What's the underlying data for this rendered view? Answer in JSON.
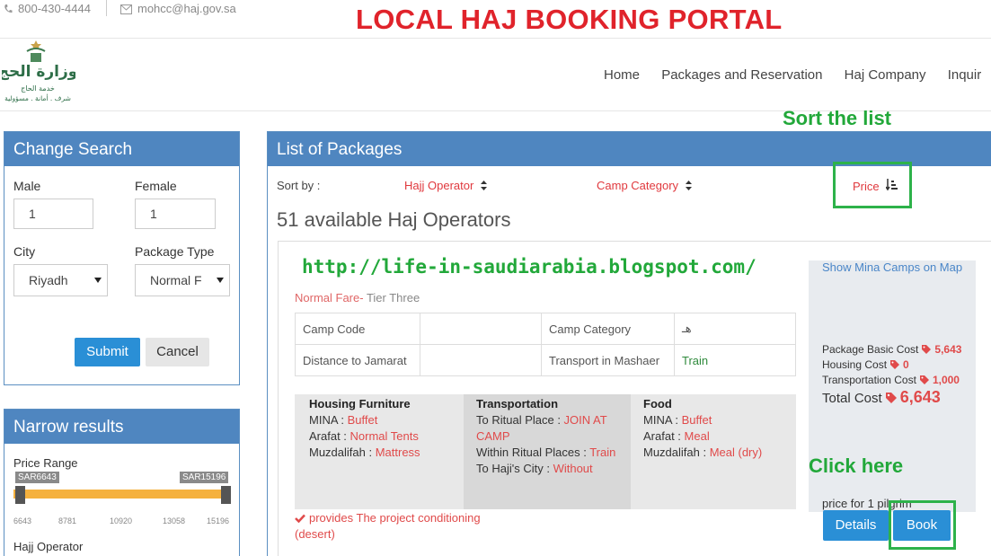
{
  "topbar": {
    "phone": "800-430-4444",
    "email": "mohcc@haj.gov.sa"
  },
  "overlay": {
    "portal_title": "LOCAL HAJ BOOKING PORTAL",
    "sort_note": "Sort the list",
    "blog_url": "http://life-in-saudiarabia.blogspot.com/",
    "click_note": "Click here"
  },
  "logo": {
    "text_ar": "وزارة الحج",
    "subtitle_ar": "خدمة الحاج",
    "motto_ar": "شرف . أمانة . مسؤولية"
  },
  "nav": {
    "items": [
      "Home",
      "Packages and Reservation",
      "Haj Company",
      "Inquir"
    ]
  },
  "search": {
    "title": "Change Search",
    "male_label": "Male",
    "male_value": "1",
    "female_label": "Female",
    "female_value": "1",
    "city_label": "City",
    "city_value": "Riyadh",
    "package_type_label": "Package Type",
    "package_type_value": "Normal F",
    "submit_label": "Submit",
    "cancel_label": "Cancel"
  },
  "narrow": {
    "title": "Narrow results",
    "price_range_label": "Price Range",
    "min_badge": "SAR6643",
    "max_badge": "SAR15196",
    "ticks": [
      "6643",
      "8781",
      "10920",
      "13058",
      "15196"
    ],
    "hajj_operator_label": "Hajj Operator"
  },
  "packages": {
    "title": "List of Packages",
    "sort_by_label": "Sort by :",
    "sort_options": [
      "Hajj Operator",
      "Camp Category",
      "Price"
    ],
    "count_text": "51 available Haj Operators"
  },
  "card": {
    "fare_label": "Normal Fare-",
    "fare_tier": " Tier Three",
    "camp_code_label": "Camp Code",
    "camp_code_value": "",
    "camp_category_label": "Camp Category",
    "camp_category_value": "هـ",
    "distance_label": "Distance to Jamarat",
    "distance_value": "",
    "transport_label": "Transport in Mashaer",
    "transport_value": "Train",
    "housing": {
      "title": "Housing Furniture",
      "mina_label": "MINA : ",
      "mina_value": "Buffet",
      "arafat_label": "Arafat : ",
      "arafat_value": "Normal Tents",
      "muzdalifah_label": "Muzdalifah : ",
      "muzdalifah_value": "Mattress"
    },
    "transportation": {
      "title": "Transportation",
      "ritual_label": "To Ritual Place : ",
      "ritual_value": "JOIN AT CAMP",
      "within_label": "Within Ritual Places : ",
      "within_value": "Train",
      "city_label": "To Haji's City : ",
      "city_value": "Without"
    },
    "food": {
      "title": "Food",
      "mina_label": "MINA : ",
      "mina_value": "Buffet",
      "arafat_label": "Arafat : ",
      "arafat_value": "Meal",
      "muzdalifah_label": "Muzdalifah : ",
      "muzdalifah_value": "Meal (dry)"
    },
    "provides_text": "provides The project conditioning (desert)",
    "mina_map_link": "Show Mina Camps on Map",
    "basic_cost_label": "Package Basic Cost",
    "basic_cost_value": "5,643",
    "housing_cost_label": "Housing Cost",
    "housing_cost_value": "0",
    "transport_cost_label": "Transportation Cost",
    "transport_cost_value": "1,000",
    "total_cost_label": "Total Cost",
    "total_cost_value": "6,643",
    "price_for_text": "price for 1 pilgrim",
    "details_label": "Details",
    "book_label": "Book"
  },
  "colors": {
    "panel_header": "#4f86c0",
    "primary_button": "#2a8fd6",
    "accent_red": "#e0232b",
    "annotation_green": "#22a83a",
    "range_fill": "#f5b13e"
  }
}
